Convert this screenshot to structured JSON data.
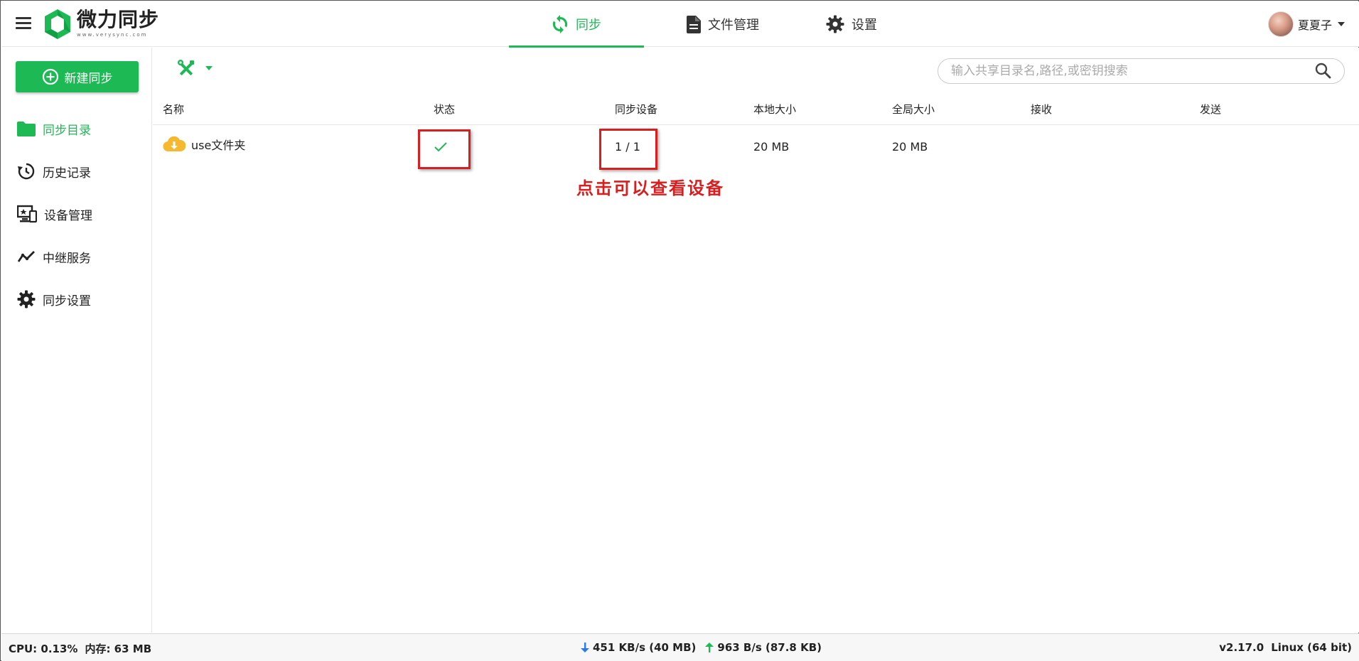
{
  "header": {
    "app_name": "微力同步",
    "app_sub": "www.verysync.com",
    "tabs": [
      {
        "label": "同步"
      },
      {
        "label": "文件管理"
      },
      {
        "label": "设置"
      }
    ],
    "user_name": "夏夏子"
  },
  "sidebar": {
    "new_sync_label": "新建同步",
    "items": [
      {
        "label": "同步目录"
      },
      {
        "label": "历史记录"
      },
      {
        "label": "设备管理"
      },
      {
        "label": "中继服务"
      },
      {
        "label": "同步设置"
      }
    ]
  },
  "main": {
    "search_placeholder": "输入共享目录名,路径,或密钥搜索",
    "columns": [
      "名称",
      "状态",
      "同步设备",
      "本地大小",
      "全局大小",
      "接收",
      "发送"
    ],
    "rows": [
      {
        "name": "use文件夹",
        "devices": "1 / 1",
        "local_size": "20 MB",
        "global_size": "20 MB",
        "receive": "",
        "send": ""
      }
    ],
    "annotation": "点击可以查看设备"
  },
  "footer": {
    "cpu": "CPU: 0.13%",
    "memory": "内存: 63 MB",
    "download": "451 KB/s (40 MB)",
    "upload": "963 B/s (87.8 KB)",
    "version": "v2.17.0",
    "os": "Linux (64 bit)"
  },
  "colors": {
    "accent": "#1db954",
    "annotation": "#d81e1e",
    "folder_icon": "#f5b82e",
    "download_arrow": "#2a7be4",
    "upload_arrow": "#1db954"
  }
}
